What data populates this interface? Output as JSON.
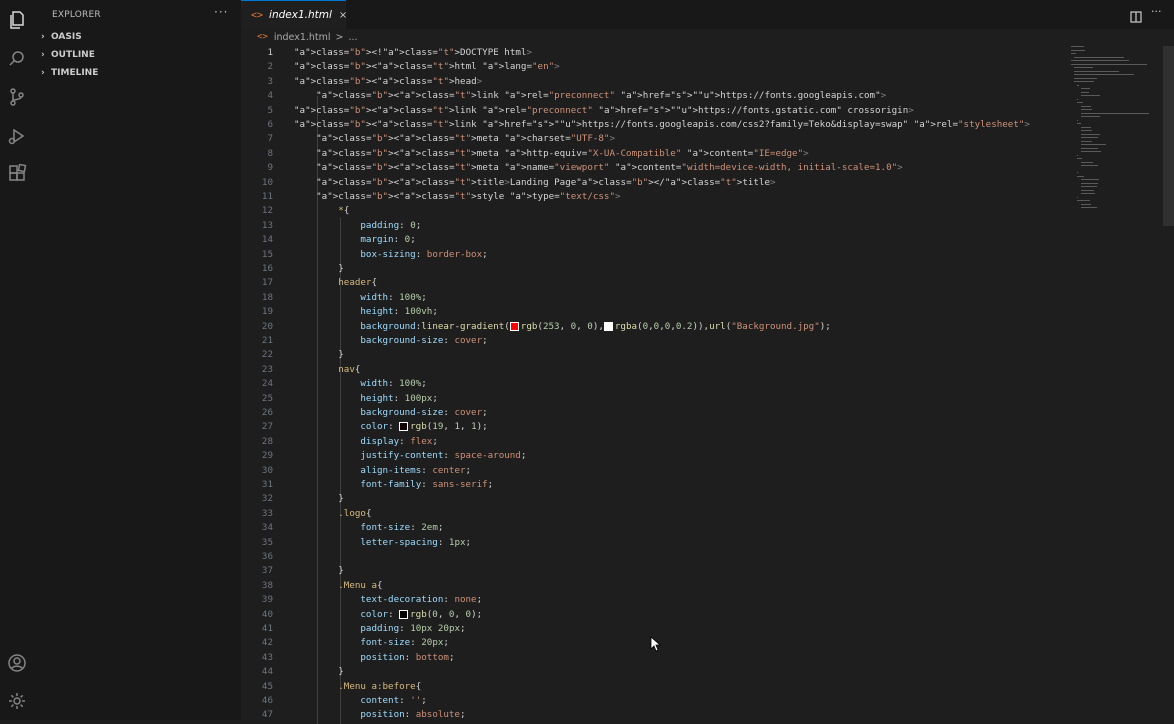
{
  "sidebar": {
    "title": "EXPLORER",
    "more": "···",
    "sections": [
      {
        "label": "OASIS"
      },
      {
        "label": "OUTLINE"
      },
      {
        "label": "TIMELINE"
      }
    ]
  },
  "tab": {
    "icon": "<>",
    "label": "index1.html",
    "close": "×"
  },
  "breadcrumb": {
    "icon": "<>",
    "file": "index1.html",
    "sep": ">",
    "more": "..."
  },
  "colors": {
    "swatch_red": "#fd0000",
    "swatch_white": "#ffffff",
    "swatch_dark": "#130101",
    "swatch_black": "#000000"
  },
  "code_lines": [
    "<!DOCTYPE html>",
    "<html lang=\"en\">",
    "<head>",
    "    <link rel=\"preconnect\" href=\"https://fonts.googleapis.com\">",
    "<link rel=\"preconnect\" href=\"https://fonts.gstatic.com\" crossorigin>",
    "<link href=\"https://fonts.googleapis.com/css2?family=Teko&display=swap\" rel=\"stylesheet\">",
    "    <meta charset=\"UTF-8\">",
    "    <meta http-equiv=\"X-UA-Compatible\" content=\"IE=edge\">",
    "    <meta name=\"viewport\" content=\"width=device-width, initial-scale=1.0\">",
    "    <title>Landing Page</title>",
    "    <style type=\"text/css\">",
    "        *{",
    "            padding: 0;",
    "            margin: 0;",
    "            box-sizing: border-box;",
    "        }",
    "        header{",
    "            width: 100%;",
    "            height: 100vh;",
    "            background:linear-gradient(rgb(253, 0, 0),rgba(0,0,0,0.2)),url(\"Background.jpg\");",
    "            background-size: cover;",
    "        }",
    "        nav{",
    "            width: 100%;",
    "            height: 100px;",
    "            background-size: cover;",
    "            color: rgb(19, 1, 1);",
    "            display: flex;",
    "            justify-content: space-around;",
    "            align-items: center;",
    "            font-family: sans-serif;",
    "        }",
    "        .logo{",
    "            font-size: 2em;",
    "            letter-spacing: 1px;",
    "",
    "        }",
    "        .Menu a{",
    "            text-decoration: none;",
    "            color: rgb(0, 0, 0);",
    "            padding: 10px 20px;",
    "            font-size: 20px;",
    "            position: bottom;",
    "        }",
    "        .Menu a:before{",
    "            content: '';",
    "            position: absolute;"
  ]
}
